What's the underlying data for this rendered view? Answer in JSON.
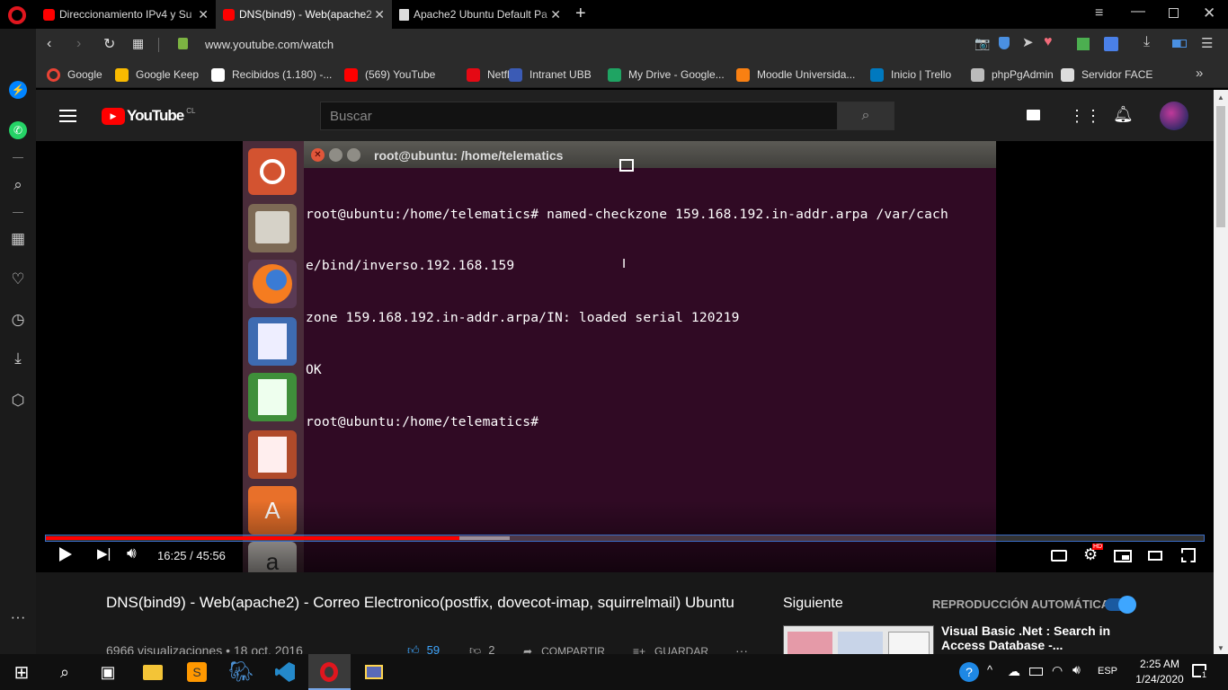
{
  "tabs": [
    {
      "label": "Direccionamiento IPv4 y Su",
      "icon": "youtube-icon"
    },
    {
      "label": "DNS(bind9) - Web(apache2",
      "icon": "youtube-icon",
      "active": true
    },
    {
      "label": "Apache2 Ubuntu Default Pa",
      "icon": "page-icon"
    }
  ],
  "address": {
    "url": "www.youtube.com/watch"
  },
  "bookmarks": [
    {
      "label": "Google",
      "icon": "google-icon",
      "color": "#ffffff"
    },
    {
      "label": "Google Keep",
      "icon": "keep-icon",
      "color": "#f9ba00"
    },
    {
      "label": "Recibidos (1.180) -...",
      "icon": "gmail-icon",
      "color": "#ffffff"
    },
    {
      "label": "(569) YouTube",
      "icon": "youtube-icon",
      "color": "#ff0000"
    },
    {
      "label": "Netflix",
      "icon": "netflix-icon",
      "color": "#e50914"
    },
    {
      "label": "Intranet UBB",
      "icon": "ubb-icon",
      "color": "#3b5bb5"
    },
    {
      "label": "My Drive - Google...",
      "icon": "drive-icon",
      "color": "#1fa463"
    },
    {
      "label": "Moodle Universida...",
      "icon": "moodle-icon",
      "color": "#f98012"
    },
    {
      "label": "Inicio | Trello",
      "icon": "trello-icon",
      "color": "#0079bf"
    },
    {
      "label": "phpPgAdmin",
      "icon": "elephant-icon",
      "color": "#bbbbbb"
    },
    {
      "label": "Servidor FACE",
      "icon": "page-icon",
      "color": "#dddddd"
    }
  ],
  "youtube": {
    "logo_text": "YouTube",
    "region": "CL",
    "search_placeholder": "Buscar"
  },
  "video": {
    "terminal_title": "root@ubuntu: /home/telematics",
    "terminal_lines": [
      "root@ubuntu:/home/telematics# named-checkzone 159.168.192.in-addr.arpa /var/cach",
      "e/bind/inverso.192.168.159",
      "zone 159.168.192.in-addr.arpa/IN: loaded serial 120219",
      "OK",
      "root@ubuntu:/home/telematics#"
    ],
    "time": "16:25 / 45:56",
    "progress_fraction": 0.357,
    "buffered_fraction": 0.401
  },
  "info": {
    "title": "DNS(bind9) - Web(apache2) - Correo Electronico(postfix, dovecot-imap, squirrelmail) Ubuntu",
    "views": "6966 visualizaciones • 18 oct. 2016",
    "likes": "59",
    "dislikes": "2",
    "share": "COMPARTIR",
    "save": "GUARDAR",
    "up_next": "Siguiente",
    "autoplay": "REPRODUCCIÓN AUTOMÁTICA",
    "next_title": "Visual Basic .Net : Search in Access Database -..."
  },
  "taskbar": {
    "lang": "ESP",
    "time": "2:25 AM",
    "date": "1/24/2020",
    "notif_count": "1"
  }
}
